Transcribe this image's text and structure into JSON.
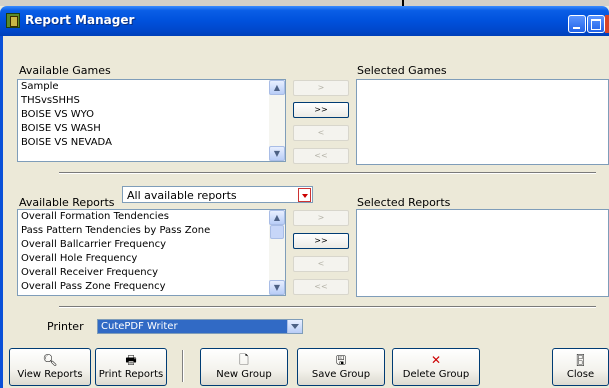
{
  "window": {
    "title": "Report Manager"
  },
  "colors": {
    "titlebar": "#0a5ee6",
    "window_bg": "#ece9d8",
    "selection": "#316ac5",
    "delete_icon": "#cc0000"
  },
  "games": {
    "available_label": "Available Games",
    "selected_label": "Selected Games",
    "available_items": [
      "Sample",
      "THSvsSHHS",
      "BOISE VS WYO",
      "BOISE VS WASH",
      "BOISE VS NEVADA"
    ],
    "buttons": {
      "add": ">",
      "add_all": ">>",
      "remove": "<",
      "remove_all": "<<"
    }
  },
  "reports": {
    "available_label": "Available Reports",
    "selected_label": "Selected Reports",
    "filter_value": "All available reports",
    "available_items": [
      "Overall Formation Tendencies",
      "Pass Pattern Tendencies by Pass Zone",
      "Overall Ballcarrier Frequency",
      "Overall Hole Frequency",
      "Overall Receiver Frequency",
      "Overall Pass Zone Frequency"
    ],
    "buttons": {
      "add": ">",
      "add_all": ">>",
      "remove": "<",
      "remove_all": "<<"
    }
  },
  "printer": {
    "label": "Printer",
    "value": "CutePDF Writer"
  },
  "toolbar": {
    "view_reports": "View Reports",
    "print_reports": "Print Reports",
    "new_group": "New Group",
    "save_group": "Save Group",
    "delete_group": "Delete Group",
    "close": "Close"
  },
  "icons": {
    "view_reports": "magnifier-page-icon",
    "print_reports": "printer-icon",
    "new_group": "blank-page-icon",
    "save_group": "floppy-disk-icon",
    "delete_group": "red-x-icon",
    "close": "exit-door-icon"
  }
}
